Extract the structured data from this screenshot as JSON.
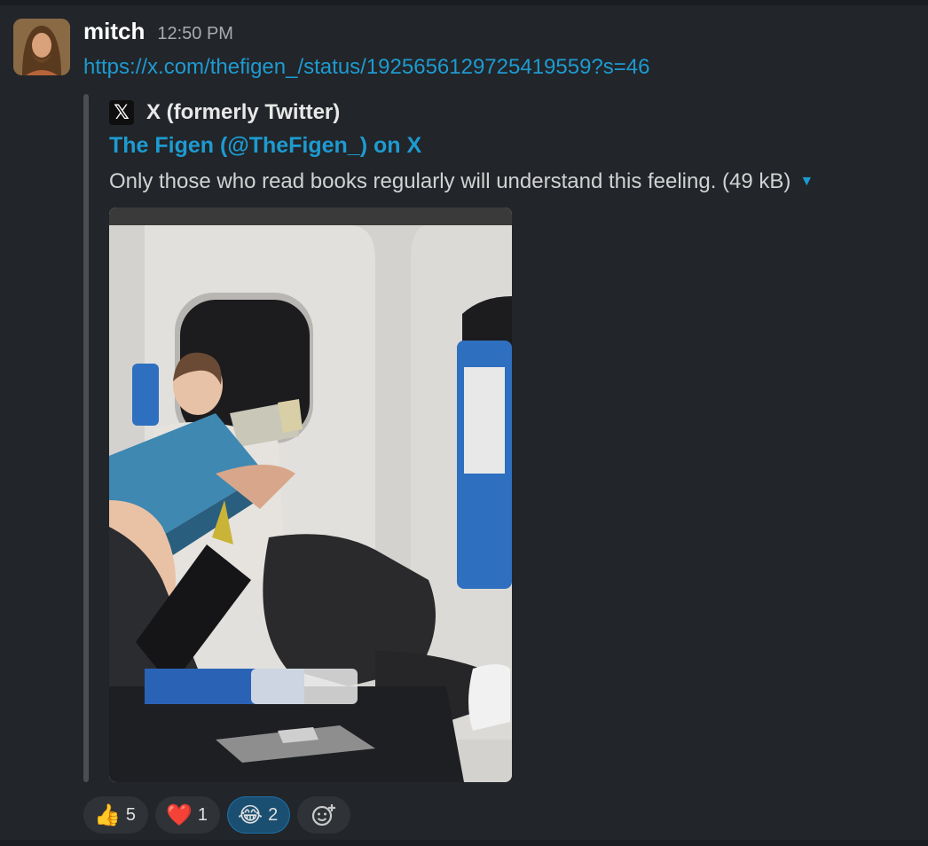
{
  "message": {
    "username": "mitch",
    "timestamp": "12:50 PM",
    "link": "https://x.com/thefigen_/status/1925656129725419559?s=46"
  },
  "unfurl": {
    "source_name": "X (formerly Twitter)",
    "source_icon": "x-logo-icon",
    "title": "The Figen (@TheFigen_) on X",
    "description": "Only those who read books regularly will understand this feeling. (49 kB)",
    "media_icon": "video-preview"
  },
  "reactions": [
    {
      "emoji": "👍",
      "icon": "thumbs-up-icon",
      "count": "5",
      "active": false
    },
    {
      "emoji": "❤️",
      "icon": "heart-icon",
      "count": "1",
      "active": false
    },
    {
      "emoji": "😂",
      "icon": "laughing-face-icon",
      "count": "2",
      "active": true
    }
  ],
  "add_reaction_icon": "add-reaction-icon",
  "colors": {
    "background": "#222529",
    "link": "#1d9bd1",
    "active_reaction": "#1b4f72"
  }
}
